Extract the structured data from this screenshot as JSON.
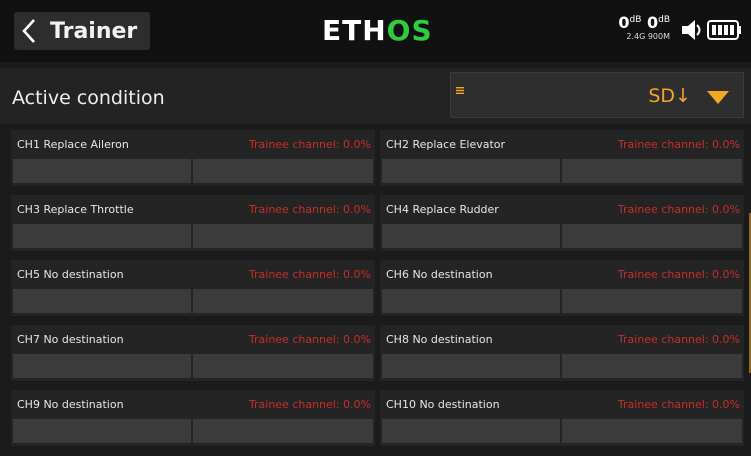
{
  "header": {
    "title": "Trainer",
    "logo_left": "ETH",
    "logo_right": "OS",
    "rssi1_value": "0",
    "rssi1_unit": "dB",
    "rssi2_value": "0",
    "rssi2_unit": "dB",
    "band_label": "2.4G 900M"
  },
  "condition": {
    "label": "Active condition",
    "value": "SD↓",
    "accent_color": "#f5a623"
  },
  "channels": [
    {
      "label": "CH1 Replace Aileron",
      "status": "Trainee channel: 0.0%"
    },
    {
      "label": "CH2 Replace Elevator",
      "status": "Trainee channel: 0.0%"
    },
    {
      "label": "CH3 Replace Throttle",
      "status": "Trainee channel: 0.0%"
    },
    {
      "label": "CH4 Replace Rudder",
      "status": "Trainee channel: 0.0%"
    },
    {
      "label": "CH5 No destination",
      "status": "Trainee channel: 0.0%"
    },
    {
      "label": "CH6 No destination",
      "status": "Trainee channel: 0.0%"
    },
    {
      "label": "CH7 No destination",
      "status": "Trainee channel: 0.0%"
    },
    {
      "label": "CH8 No destination",
      "status": "Trainee channel: 0.0%"
    },
    {
      "label": "CH9 No destination",
      "status": "Trainee channel: 0.0%"
    },
    {
      "label": "CH10 No destination",
      "status": "Trainee channel: 0.0%"
    }
  ],
  "icons": {
    "back": "chevron-left-icon",
    "menu": "menu-icon",
    "dropdown": "triangle-down-icon",
    "volume": "speaker-icon",
    "battery": "battery-icon"
  },
  "colors": {
    "status_red": "#c62d2d",
    "logo_green": "#2ecc40"
  }
}
